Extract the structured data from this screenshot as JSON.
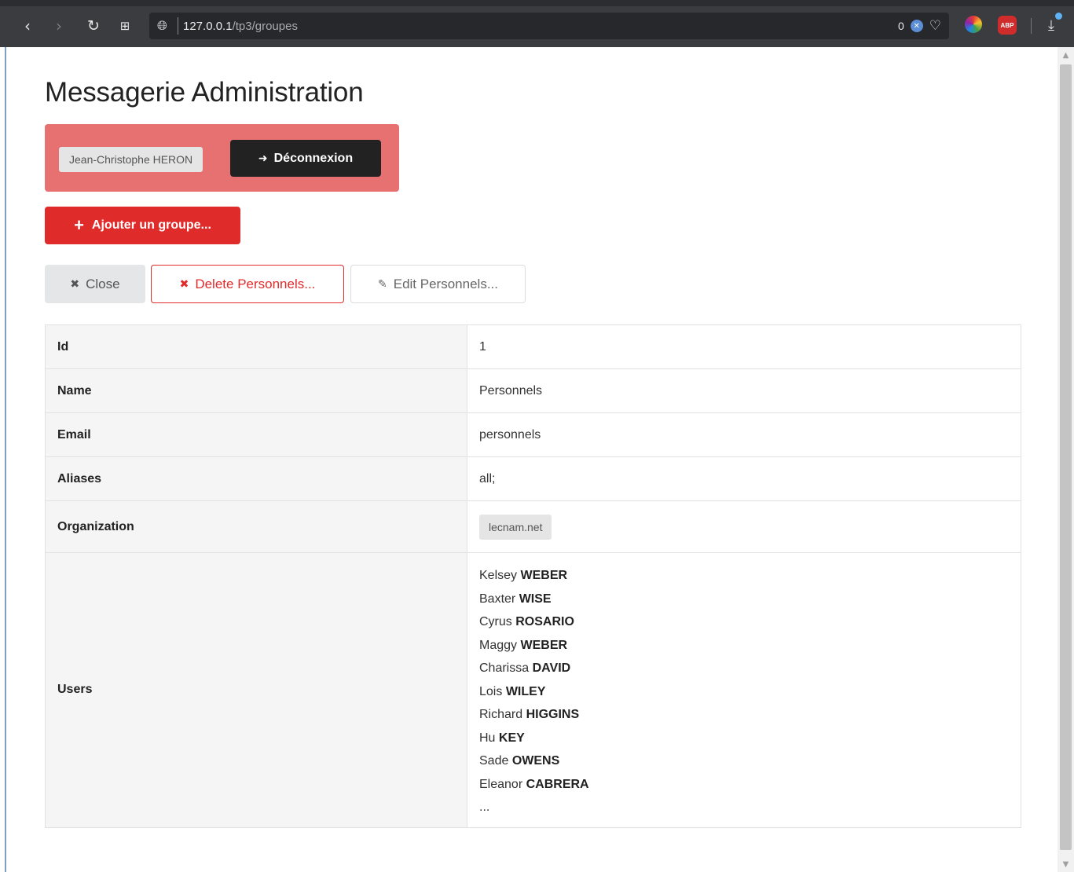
{
  "browser": {
    "url_host": "127.0.0.1",
    "url_path": "/tp3/groupes",
    "blocked_count": "0",
    "abp_label": "ABP"
  },
  "page": {
    "title": "Messagerie Administration"
  },
  "user_bar": {
    "username": "Jean-Christophe HERON",
    "logout_label": "Déconnexion"
  },
  "add_group_label": "Ajouter un groupe...",
  "actions": {
    "close_label": "Close",
    "delete_prefix": "Delete",
    "delete_group": "Personnels...",
    "edit_prefix": "Edit",
    "edit_group": "Personnels..."
  },
  "details": {
    "id_label": "Id",
    "id_value": "1",
    "name_label": "Name",
    "name_value": "Personnels",
    "email_label": "Email",
    "email_value": "personnels",
    "aliases_label": "Aliases",
    "aliases_value": "all;",
    "organization_label": "Organization",
    "organization_value": "lecnam.net",
    "users_label": "Users",
    "users": [
      {
        "first": "Kelsey",
        "last": "WEBER"
      },
      {
        "first": "Baxter",
        "last": "WISE"
      },
      {
        "first": "Cyrus",
        "last": "ROSARIO"
      },
      {
        "first": "Maggy",
        "last": "WEBER"
      },
      {
        "first": "Charissa",
        "last": "DAVID"
      },
      {
        "first": "Lois",
        "last": "WILEY"
      },
      {
        "first": "Richard",
        "last": "HIGGINS"
      },
      {
        "first": "Hu",
        "last": "KEY"
      },
      {
        "first": "Sade",
        "last": "OWENS"
      },
      {
        "first": "Eleanor",
        "last": "CABRERA"
      }
    ],
    "users_more": "..."
  }
}
